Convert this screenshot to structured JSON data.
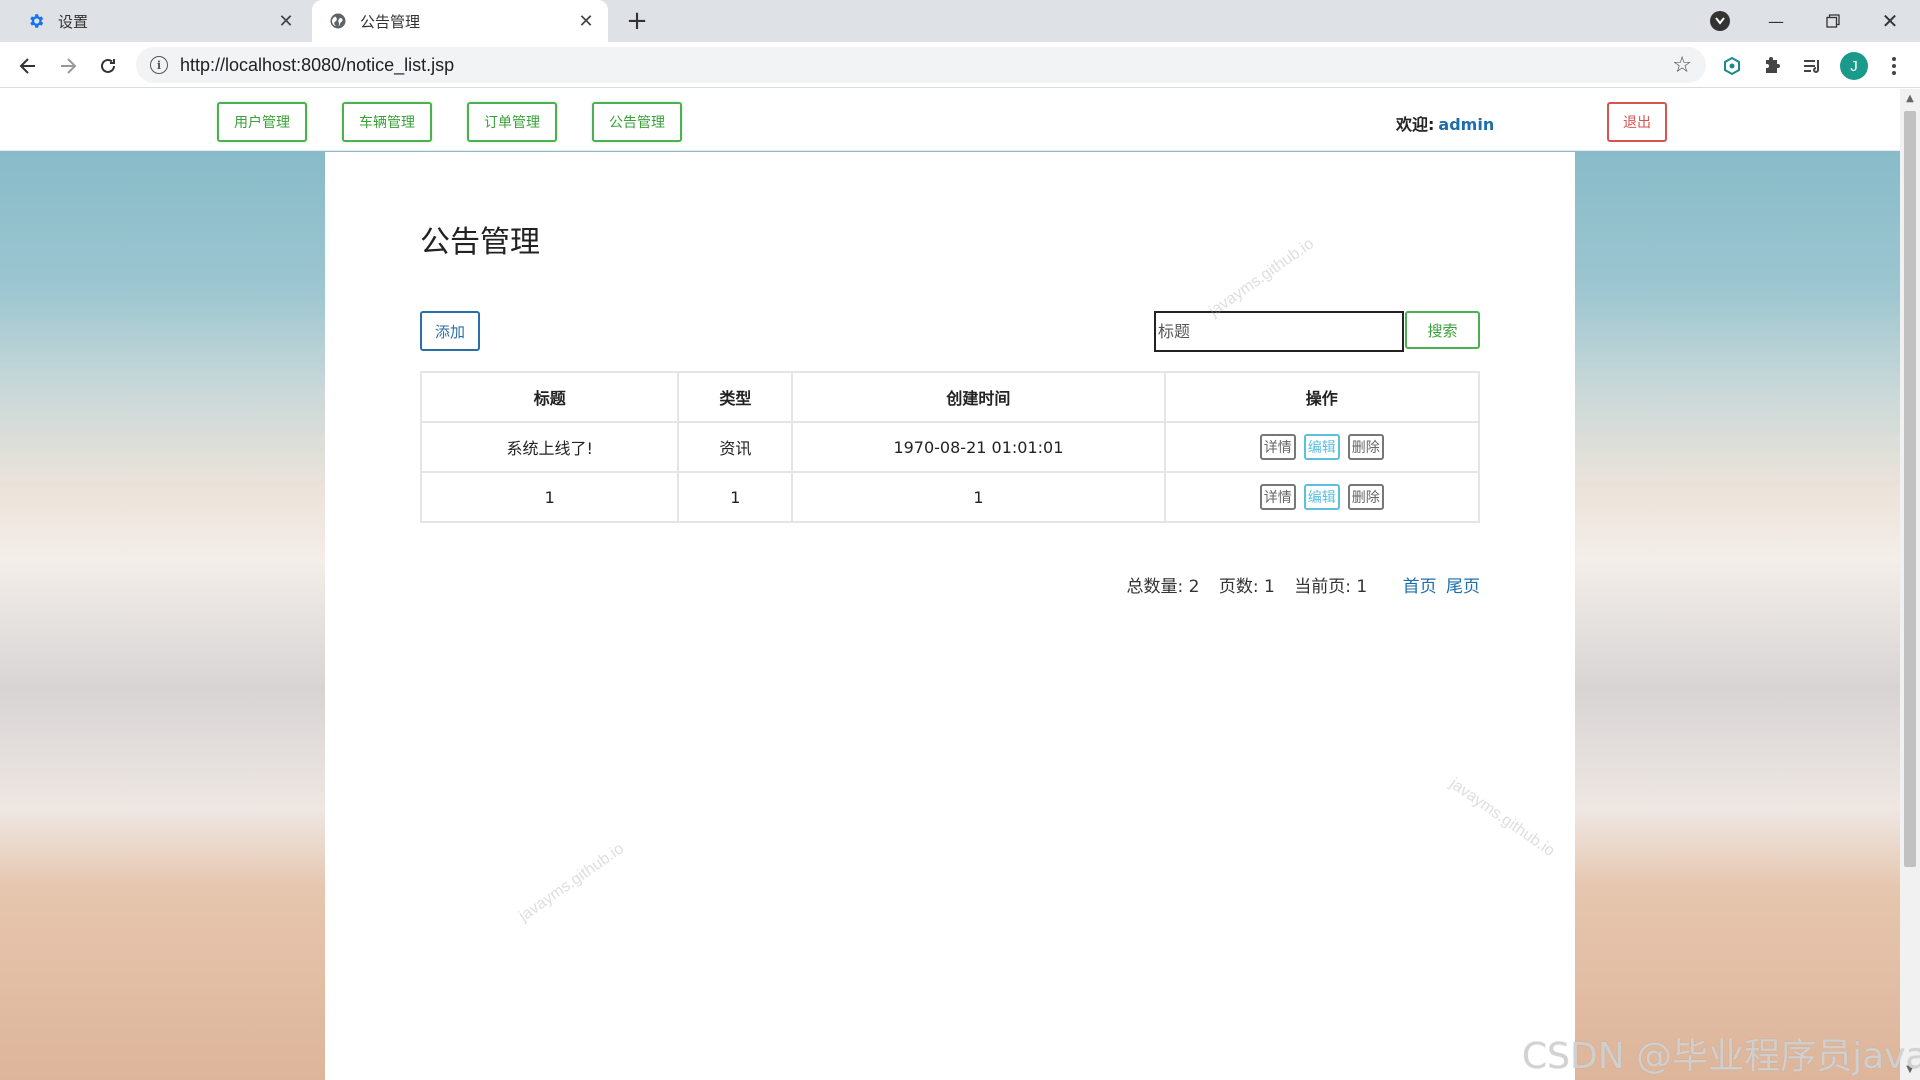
{
  "browser": {
    "tabs": [
      {
        "title": "设置",
        "icon": "gear-icon",
        "active": false
      },
      {
        "title": "公告管理",
        "icon": "globe-icon",
        "active": true
      }
    ],
    "url": "http://localhost:8080/notice_list.jsp",
    "profile_initial": "J"
  },
  "nav": {
    "items": [
      "用户管理",
      "车辆管理",
      "订单管理",
      "公告管理"
    ],
    "welcome_label": "欢迎:",
    "username": "admin",
    "logout_label": "退出"
  },
  "page": {
    "title": "公告管理",
    "add_label": "添加",
    "search_placeholder": "标题",
    "search_label": "搜索"
  },
  "table": {
    "headers": [
      "标题",
      "类型",
      "创建时间",
      "操作"
    ],
    "rows": [
      {
        "title": "系统上线了!",
        "type": "资讯",
        "created": "1970-08-21 01:01:01",
        "actions": [
          "详情",
          "编辑",
          "删除"
        ]
      },
      {
        "title": "1",
        "type": "1",
        "created": "1",
        "actions": [
          "详情",
          "编辑",
          "删除"
        ]
      }
    ]
  },
  "pager": {
    "total": "总数量: 2",
    "pages": "页数: 1",
    "current": "当前页: 1",
    "first": "首页",
    "last": "尾页"
  },
  "watermarks": [
    "javayms.github.io"
  ],
  "csdn_watermark": "CSDN @毕业程序员java",
  "colors": {
    "nav_green": "#4caf50",
    "logout_red": "#d9534f",
    "primary_blue": "#2a6fa8",
    "edit_cyan": "#5bc0de"
  }
}
